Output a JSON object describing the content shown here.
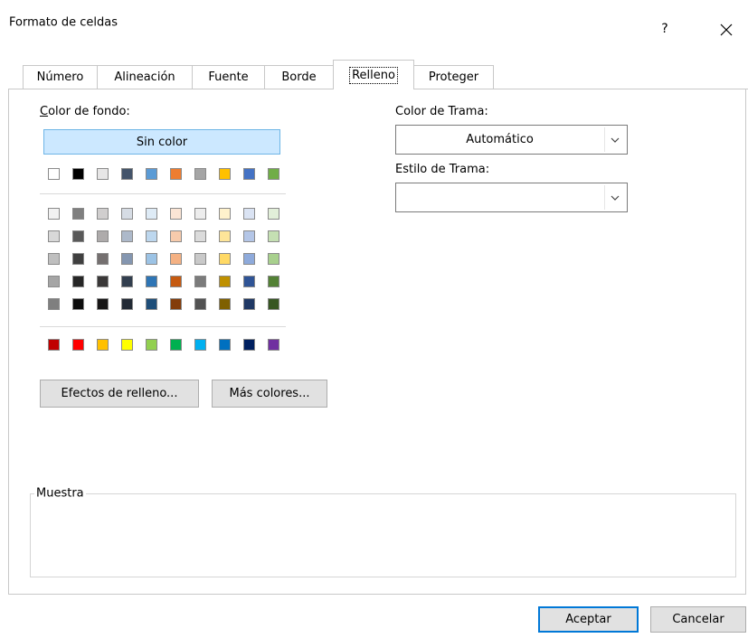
{
  "window": {
    "title": "Formato de celdas",
    "help_label": "?"
  },
  "tabs": [
    {
      "label": "Número"
    },
    {
      "label": "Alineación"
    },
    {
      "label": "Fuente"
    },
    {
      "label": "Borde"
    },
    {
      "label": "Relleno",
      "active": true
    },
    {
      "label": "Proteger"
    }
  ],
  "background": {
    "label": "Color de fondo:",
    "no_color_label": "Sin color",
    "palette": {
      "top_row": [
        "#ffffff",
        "#000000",
        "#e7e6e6",
        "#44546a",
        "#5b9bd5",
        "#ed7d31",
        "#a5a5a5",
        "#ffc000",
        "#4472c4",
        "#70ad47"
      ],
      "shade_rows": [
        [
          "#f2f2f2",
          "#7f7f7f",
          "#d0cece",
          "#d6dce4",
          "#deebf6",
          "#fbe5d5",
          "#ededed",
          "#fff2cc",
          "#dae3f3",
          "#e2efd9"
        ],
        [
          "#d8d8d8",
          "#595959",
          "#aeabab",
          "#adb9ca",
          "#bdd7ee",
          "#f7cbac",
          "#dbdbdb",
          "#fee599",
          "#b4c6e7",
          "#c5e0b3"
        ],
        [
          "#bfbfbf",
          "#3f3f3f",
          "#757070",
          "#8496b0",
          "#9cc3e5",
          "#f4b183",
          "#c9c9c9",
          "#ffd965",
          "#8eaadb",
          "#a8d08d"
        ],
        [
          "#a5a5a5",
          "#262626",
          "#3a3838",
          "#323f4f",
          "#2e75b5",
          "#c55a11",
          "#7b7b7b",
          "#bf9000",
          "#2f5496",
          "#538135"
        ],
        [
          "#7f7f7f",
          "#0c0c0c",
          "#171616",
          "#222a35",
          "#1e4e79",
          "#833c0b",
          "#525252",
          "#7f6000",
          "#1f3864",
          "#375623"
        ]
      ],
      "standard_row": [
        "#c00000",
        "#ff0000",
        "#ffc000",
        "#ffff00",
        "#92d050",
        "#00b050",
        "#00b0f0",
        "#0070c0",
        "#002060",
        "#7030a0"
      ]
    },
    "fill_effects_label": "Efectos de relleno...",
    "more_colors_label": "Más colores..."
  },
  "pattern": {
    "color_label": "Color de Trama:",
    "color_value": "Automático",
    "style_label": "Estilo de Trama:",
    "style_value": ""
  },
  "sample": {
    "label": "Muestra"
  },
  "footer": {
    "ok_label": "Aceptar",
    "cancel_label": "Cancelar"
  }
}
